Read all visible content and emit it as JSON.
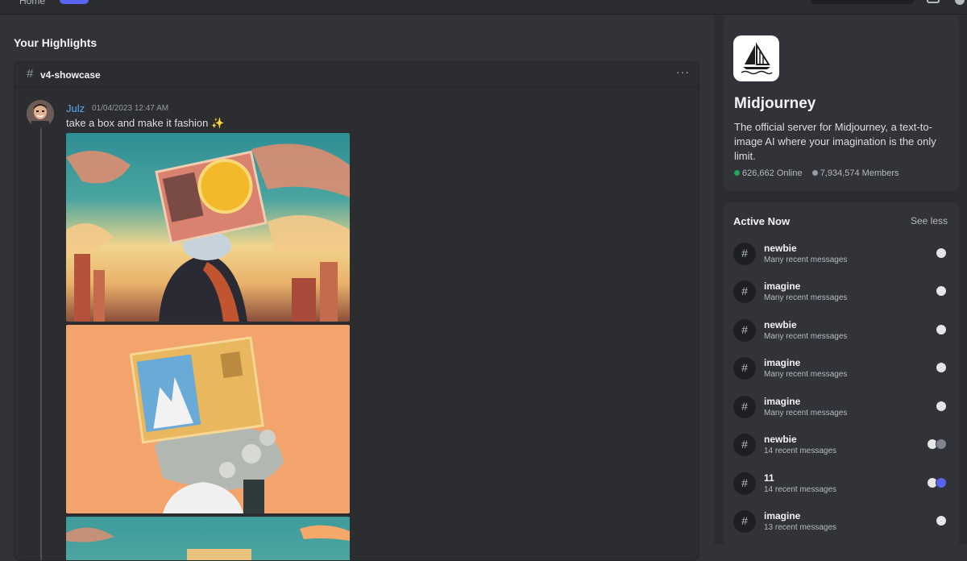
{
  "topbar": {
    "home_label": "Home"
  },
  "main": {
    "section_title": "Your Highlights",
    "channel": {
      "hash": "#",
      "name": "v4-showcase",
      "more": "···"
    },
    "message": {
      "username": "Julz",
      "timestamp": "01/04/2023 12:47 AM",
      "text": "take a box and make it fashion",
      "emoji": "✨"
    }
  },
  "server": {
    "name": "Midjourney",
    "description": "The official server for Midjourney, a text-to-image AI where your imagination is the only limit.",
    "online": "626,662 Online",
    "members": "7,934,574 Members"
  },
  "active_now": {
    "title": "Active Now",
    "see_less": "See less",
    "items": [
      {
        "name": "newbie",
        "sub": "Many recent messages"
      },
      {
        "name": "imagine",
        "sub": "Many recent messages"
      },
      {
        "name": "newbie",
        "sub": "Many recent messages"
      },
      {
        "name": "imagine",
        "sub": "Many recent messages"
      },
      {
        "name": "imagine",
        "sub": "Many recent messages"
      },
      {
        "name": "newbie",
        "sub": "14 recent messages"
      },
      {
        "name": "11",
        "sub": "14 recent messages"
      },
      {
        "name": "imagine",
        "sub": "13 recent messages"
      }
    ]
  },
  "colors": {
    "background": "#313338",
    "sidebar": "#2b2d31",
    "username": "#5fa8f4",
    "online": "#23a55a",
    "accent": "#5865f2"
  },
  "icons": [
    "home-icon",
    "search-icon",
    "inbox-icon",
    "help-icon",
    "hash-icon",
    "more-icon",
    "sailboat-logo-icon",
    "channel-thread-icon",
    "sparkles-emoji"
  ]
}
